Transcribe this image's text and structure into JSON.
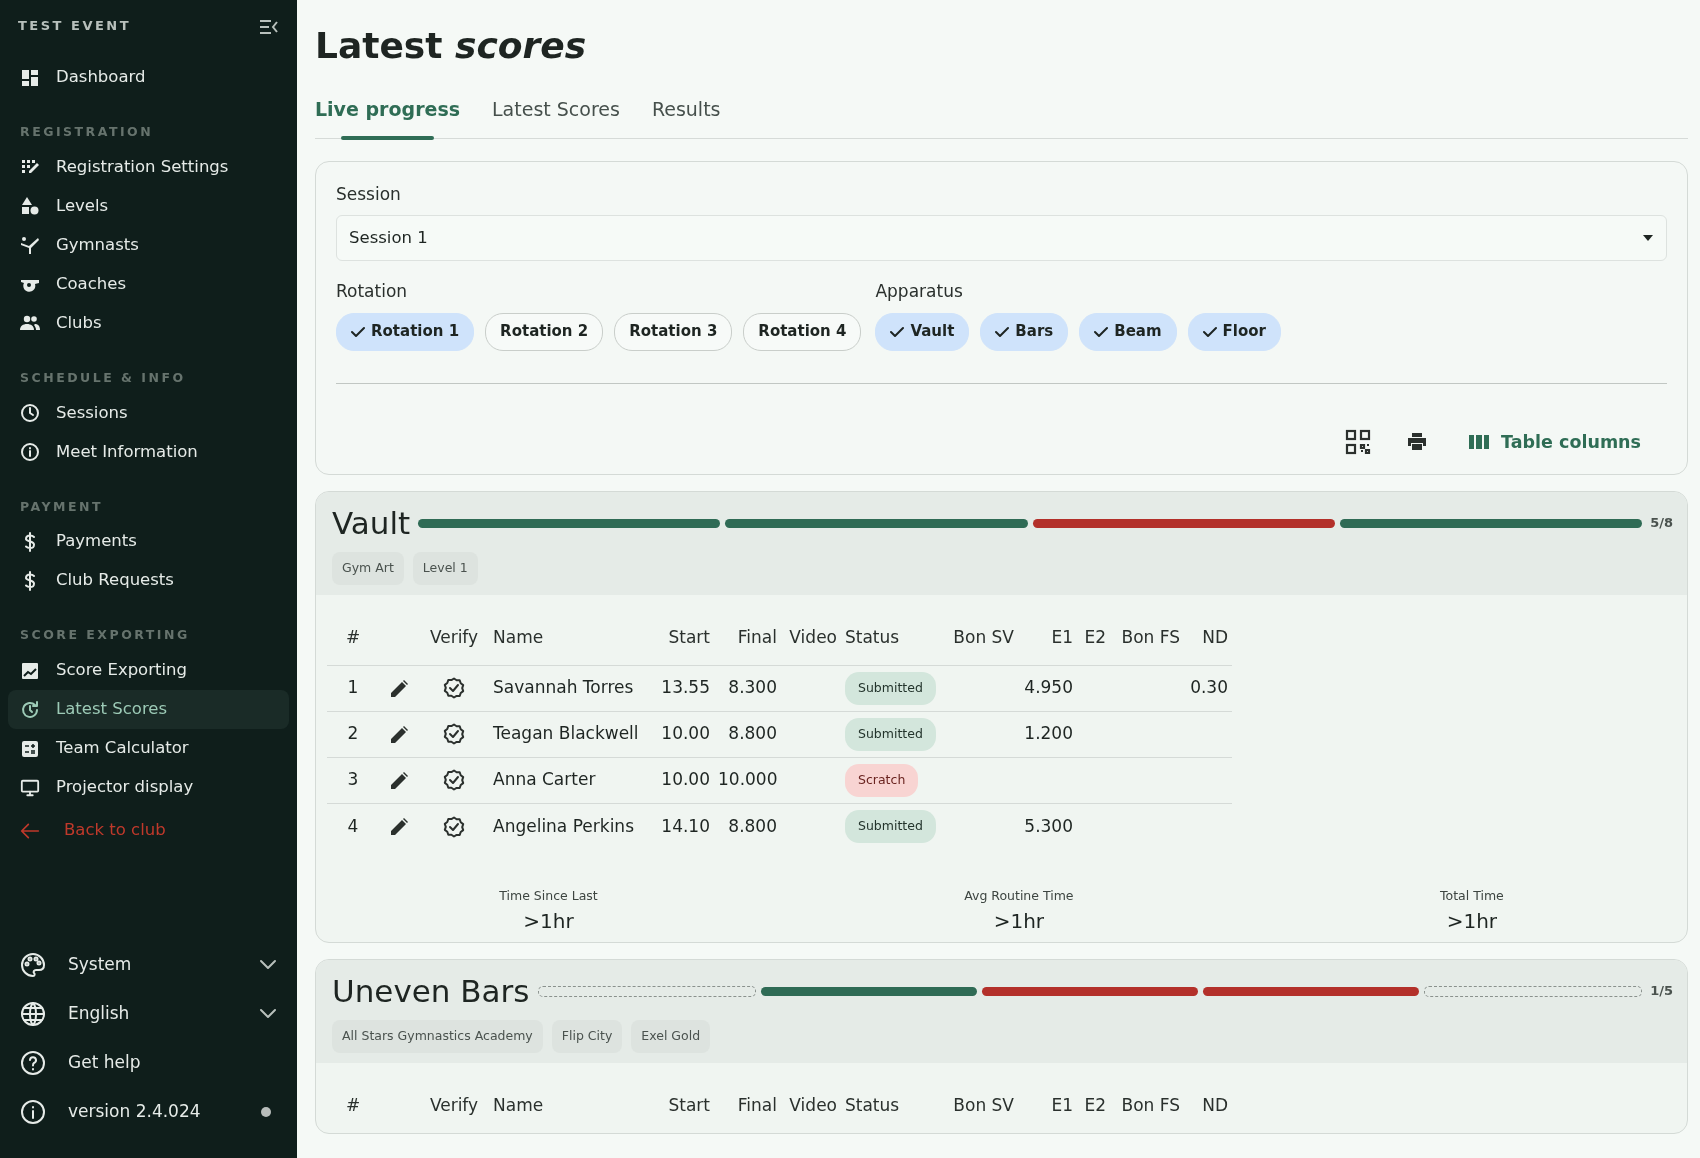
{
  "sidebar": {
    "event_title": "TEST EVENT",
    "top_items": [
      {
        "label": "Dashboard",
        "selected": false
      }
    ],
    "sections": [
      {
        "heading": "REGISTRATION",
        "items": [
          {
            "label": "Registration Settings",
            "selected": false
          },
          {
            "label": "Levels",
            "selected": false
          },
          {
            "label": "Gymnasts",
            "selected": false
          },
          {
            "label": "Coaches",
            "selected": false
          },
          {
            "label": "Clubs",
            "selected": false
          }
        ]
      },
      {
        "heading": "SCHEDULE & INFO",
        "items": [
          {
            "label": "Sessions",
            "selected": false
          },
          {
            "label": "Meet Information",
            "selected": false
          }
        ]
      },
      {
        "heading": "PAYMENT",
        "items": [
          {
            "label": "Payments",
            "selected": false
          },
          {
            "label": "Club Requests",
            "selected": false
          }
        ]
      },
      {
        "heading": "SCORE EXPORTING",
        "items": [
          {
            "label": "Score Exporting",
            "selected": false
          },
          {
            "label": "Latest Scores",
            "selected": true
          },
          {
            "label": "Team Calculator",
            "selected": false
          },
          {
            "label": "Projector display",
            "selected": false
          }
        ]
      }
    ],
    "back_link": "Back to club",
    "footer": [
      {
        "label": "System",
        "kind": "dropdown"
      },
      {
        "label": "English",
        "kind": "dropdown"
      },
      {
        "label": "Get help",
        "kind": "link"
      },
      {
        "label": "version 2.4.024",
        "kind": "version"
      }
    ]
  },
  "page_title": "Latest *scores*",
  "tabs": [
    {
      "label": "Live progress",
      "selected": true
    },
    {
      "label": "Latest Scores",
      "selected": false
    },
    {
      "label": "Results",
      "selected": false
    }
  ],
  "filters": {
    "session_label": "Session",
    "session_value": "Session 1",
    "rotation_label": "Rotation",
    "rotations": [
      {
        "label": "Rotation 1",
        "selected": true
      },
      {
        "label": "Rotation 2",
        "selected": false
      },
      {
        "label": "Rotation 3",
        "selected": false
      },
      {
        "label": "Rotation 4",
        "selected": false
      }
    ],
    "apparatus_label": "Apparatus",
    "apparatus": [
      {
        "label": "Vault",
        "selected": true
      },
      {
        "label": "Bars",
        "selected": true
      },
      {
        "label": "Beam",
        "selected": true
      },
      {
        "label": "Floor",
        "selected": true
      }
    ],
    "table_columns_button": "Table columns"
  },
  "events": [
    {
      "name": "Vault",
      "progress": [
        {
          "kind": "bar",
          "color": "#2f6b55"
        },
        {
          "kind": "bar",
          "color": "#2f6b55"
        },
        {
          "kind": "bar",
          "color": "#b3302a"
        },
        {
          "kind": "bar",
          "color": "#2f6b55"
        }
      ],
      "count": "5/8",
      "tags": [
        "Gym Art",
        "Level 1"
      ],
      "columns": [
        "#",
        "Verify",
        "Name",
        "Start",
        "Final",
        "Video",
        "Status",
        "Bon SV",
        "E1",
        "E2",
        "Bon FS",
        "ND"
      ],
      "rows": [
        {
          "cells": [
            "1",
            null,
            "Savannah Torres",
            "13.55",
            "8.300",
            null,
            {
              "text": "Submitted",
              "kind": "submitted"
            },
            null,
            "4.950",
            null,
            null,
            "0.30"
          ]
        },
        {
          "cells": [
            "2",
            null,
            "Teagan Blackwell",
            "10.00",
            "8.800",
            null,
            {
              "text": "Submitted",
              "kind": "submitted"
            },
            null,
            "1.200",
            null,
            null,
            null
          ]
        },
        {
          "cells": [
            "3",
            null,
            "Anna Carter",
            "10.00",
            "10.000",
            null,
            {
              "text": "Scratch",
              "kind": "scratch"
            },
            null,
            null,
            null,
            null,
            null
          ]
        },
        {
          "cells": [
            "4",
            null,
            "Angelina Perkins",
            "14.10",
            "8.800",
            null,
            {
              "text": "Submitted",
              "kind": "submitted"
            },
            null,
            "5.300",
            null,
            null,
            null
          ]
        }
      ],
      "stats": [
        {
          "label": "Time Since Last",
          "value": ">1hr"
        },
        {
          "label": "Avg Routine Time",
          "value": ">1hr"
        },
        {
          "label": "Total Time",
          "value": ">1hr"
        }
      ]
    },
    {
      "name": "Uneven Bars",
      "progress": [
        {
          "kind": "dashed"
        },
        {
          "kind": "bar",
          "color": "#2f6b55"
        },
        {
          "kind": "bar",
          "color": "#b3302a"
        },
        {
          "kind": "bar",
          "color": "#b3302a"
        },
        {
          "kind": "dashed"
        }
      ],
      "count": "1/5",
      "tags": [
        "All Stars Gymnastics Academy",
        "Flip City",
        "Exel Gold"
      ],
      "columns": [
        "#",
        "Verify",
        "Name",
        "Start",
        "Final",
        "Video",
        "Status",
        "Bon SV",
        "E1",
        "E2",
        "Bon FS",
        "ND"
      ]
    }
  ]
}
